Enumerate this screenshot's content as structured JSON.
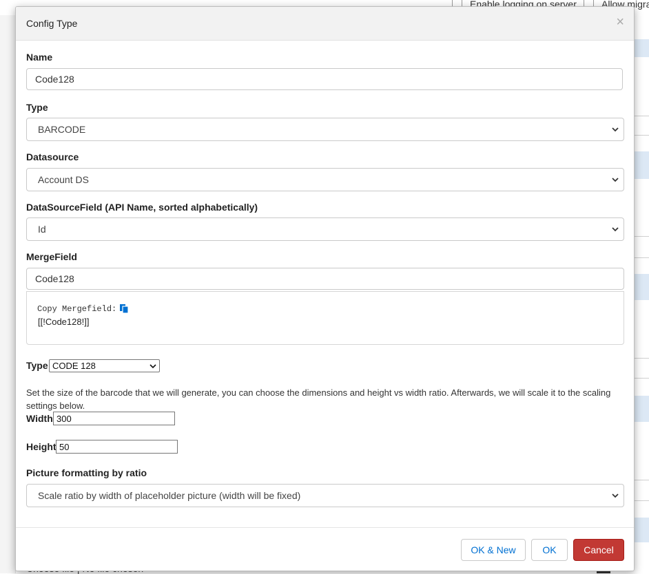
{
  "background": {
    "checkbox1_label": "Enable logging on server",
    "checkbox2_label": "Allow migra",
    "bottom_text": "Choose file | No file chosen"
  },
  "dialog": {
    "title": "Config Type",
    "close_symbol": "×",
    "name": {
      "label": "Name",
      "value": "Code128"
    },
    "type": {
      "label": "Type",
      "value": "BARCODE"
    },
    "datasource": {
      "label": "Datasource",
      "value": "Account DS"
    },
    "datasource_field": {
      "label": "DataSourceField (API Name, sorted alphabetically)",
      "value": "Id"
    },
    "merge_field": {
      "label": "MergeField",
      "value": "Code128",
      "copy_label": "Copy Mergefield:",
      "code": "[[!Code128!]]"
    },
    "barcode_type": {
      "label": "Type",
      "value": "CODE 128"
    },
    "size_help": "Set the size of the barcode that we will generate, you can choose the dimensions and height vs width ratio. Afterwards, we will scale it to the scaling settings below.",
    "width": {
      "label": "Width",
      "value": "300"
    },
    "height": {
      "label": "Height",
      "value": "50"
    },
    "picture_formatting": {
      "label": "Picture formatting by ratio",
      "value": "Scale ratio by width of placeholder picture (width will be fixed)"
    },
    "buttons": {
      "ok_new": "OK & New",
      "ok": "OK",
      "cancel": "Cancel"
    }
  },
  "colors": {
    "accent": "#0070d2",
    "danger": "#c23934",
    "header_bg": "#f2f2f2"
  },
  "icons": {
    "close": "close-icon",
    "chevron": "chevron-down-icon",
    "copy": "copy-icon"
  }
}
